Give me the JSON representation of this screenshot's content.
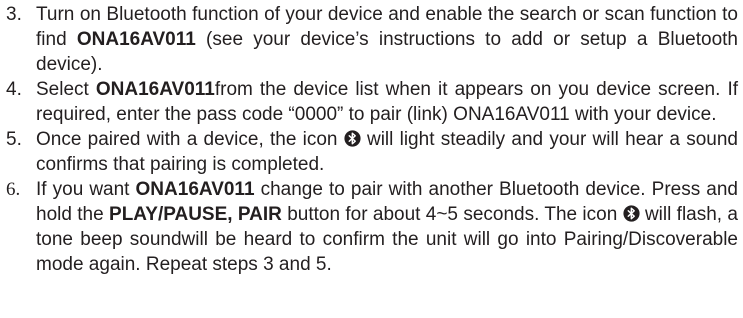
{
  "steps": [
    {
      "number": "3.",
      "parts": [
        {
          "text": "Turn on Bluetooth function of your device and enable the search or scan function to find "
        },
        {
          "text": "ONA16AV011",
          "bold": true
        },
        {
          "text": " (see your device’s instructions to add or setup a Bluetooth device)."
        }
      ]
    },
    {
      "number": "4.",
      "parts": [
        {
          "text": "Select "
        },
        {
          "text": "ONA16AV011",
          "bold": true
        },
        {
          "text": "from the device list when it appears on you device screen. If required, enter the pass code “0000” to pair (link) ONA16AV011 with your device."
        }
      ]
    },
    {
      "number": "5.",
      "parts": [
        {
          "text": "Once paired with a device, the icon "
        },
        {
          "icon": "bluetooth-icon"
        },
        {
          "text": " will light steadily and your will hear a sound confirms that pairing is completed."
        }
      ]
    },
    {
      "number": "6.",
      "number_serif": true,
      "parts": [
        {
          "text": "If you want "
        },
        {
          "text": "ONA16AV011",
          "bold": true
        },
        {
          "text": " change to pair with another Bluetooth device. Press and hold the "
        },
        {
          "text": "PLAY/PAUSE, PAIR",
          "bold": true
        },
        {
          "text": " button for about 4~5 seconds. The icon "
        },
        {
          "icon": "bluetooth-icon"
        },
        {
          "text": " will flash, a tone beep soundwill be heard to confirm the unit will go into Pairing/Discoverable mode again. Repeat steps 3 and 5."
        }
      ]
    }
  ]
}
